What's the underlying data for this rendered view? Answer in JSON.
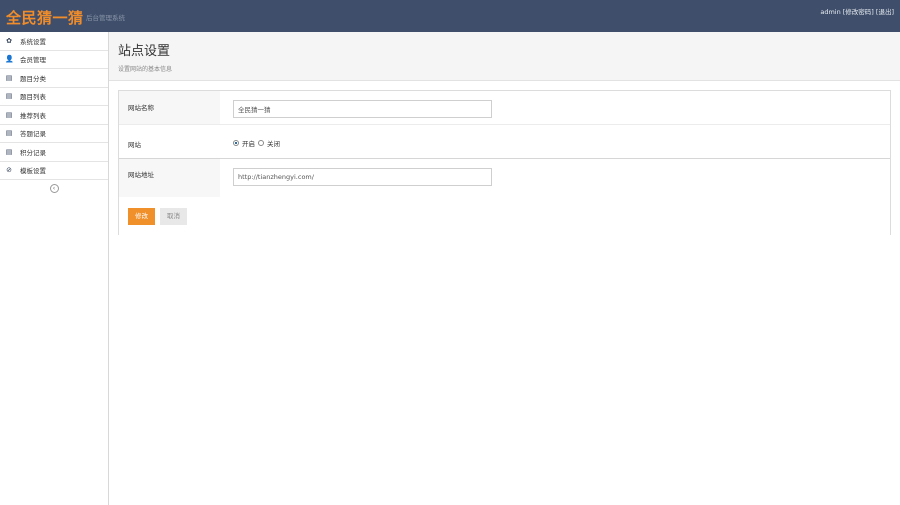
{
  "header": {
    "brand": "全民猜一猜",
    "subtitle": "后台管理系统",
    "user": "admin [修改密码] [退出]"
  },
  "sidebar": {
    "items": [
      {
        "label": "系统设置",
        "icon": "gear-icon",
        "glyph": "✿"
      },
      {
        "label": "会员管理",
        "icon": "user-icon",
        "glyph": "👤"
      },
      {
        "label": "题目分类",
        "icon": "list-icon",
        "glyph": "▤"
      },
      {
        "label": "题目列表",
        "icon": "list-icon",
        "glyph": "▤"
      },
      {
        "label": "推荐列表",
        "icon": "list-icon",
        "glyph": "▤"
      },
      {
        "label": "答题记录",
        "icon": "list-icon",
        "glyph": "▤"
      },
      {
        "label": "积分记录",
        "icon": "list-icon",
        "glyph": "▤"
      },
      {
        "label": "模板设置",
        "icon": "compass-icon",
        "glyph": "⊘"
      }
    ],
    "collapse_glyph": "‹"
  },
  "page": {
    "title": "站点设置",
    "description": "设置网站的基本信息"
  },
  "form": {
    "site_name_label": "网站名称",
    "site_name_value": "全民猜一猜",
    "status_label": "网站",
    "status_options": [
      "开启",
      "关闭"
    ],
    "status_selected": "开启",
    "site_url_label": "网站地址",
    "site_url_value": "http://tianzhengyi.com/"
  },
  "buttons": {
    "submit": "修改",
    "cancel": "取消"
  },
  "colors": {
    "topbar": "#3f4f6b",
    "brand": "#f08c2a",
    "primary_button": "#f0902a"
  }
}
